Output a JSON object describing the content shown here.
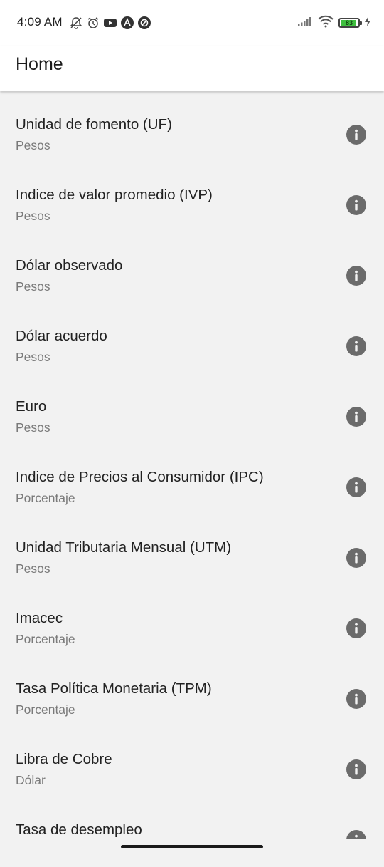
{
  "status_bar": {
    "time": "4:09 AM",
    "battery_level": "83",
    "left_icons": [
      "notifications-off-icon",
      "alarm-icon",
      "youtube-icon",
      "app-a-icon",
      "app-circle-icon"
    ],
    "right_icons": [
      "signal-icon",
      "wifi-icon",
      "battery-icon",
      "charging-icon"
    ]
  },
  "app_bar": {
    "title": "Home"
  },
  "list": {
    "items": [
      {
        "title": "Unidad de fomento (UF)",
        "subtitle": "Pesos"
      },
      {
        "title": "Indice de valor promedio (IVP)",
        "subtitle": "Pesos"
      },
      {
        "title": "Dólar observado",
        "subtitle": "Pesos"
      },
      {
        "title": "Dólar acuerdo",
        "subtitle": "Pesos"
      },
      {
        "title": "Euro",
        "subtitle": "Pesos"
      },
      {
        "title": "Indice de Precios al Consumidor (IPC)",
        "subtitle": "Porcentaje"
      },
      {
        "title": "Unidad Tributaria Mensual (UTM)",
        "subtitle": "Pesos"
      },
      {
        "title": "Imacec",
        "subtitle": "Porcentaje"
      },
      {
        "title": "Tasa Política Monetaria (TPM)",
        "subtitle": "Porcentaje"
      },
      {
        "title": "Libra de Cobre",
        "subtitle": "Dólar"
      },
      {
        "title": "Tasa de desempleo",
        "subtitle": ""
      }
    ],
    "info_icon": "info-icon"
  },
  "colors": {
    "background": "#f2f2f2",
    "app_bar": "#ffffff",
    "info_icon": "#6b6b6b",
    "battery_fill": "#3fbf3f"
  }
}
